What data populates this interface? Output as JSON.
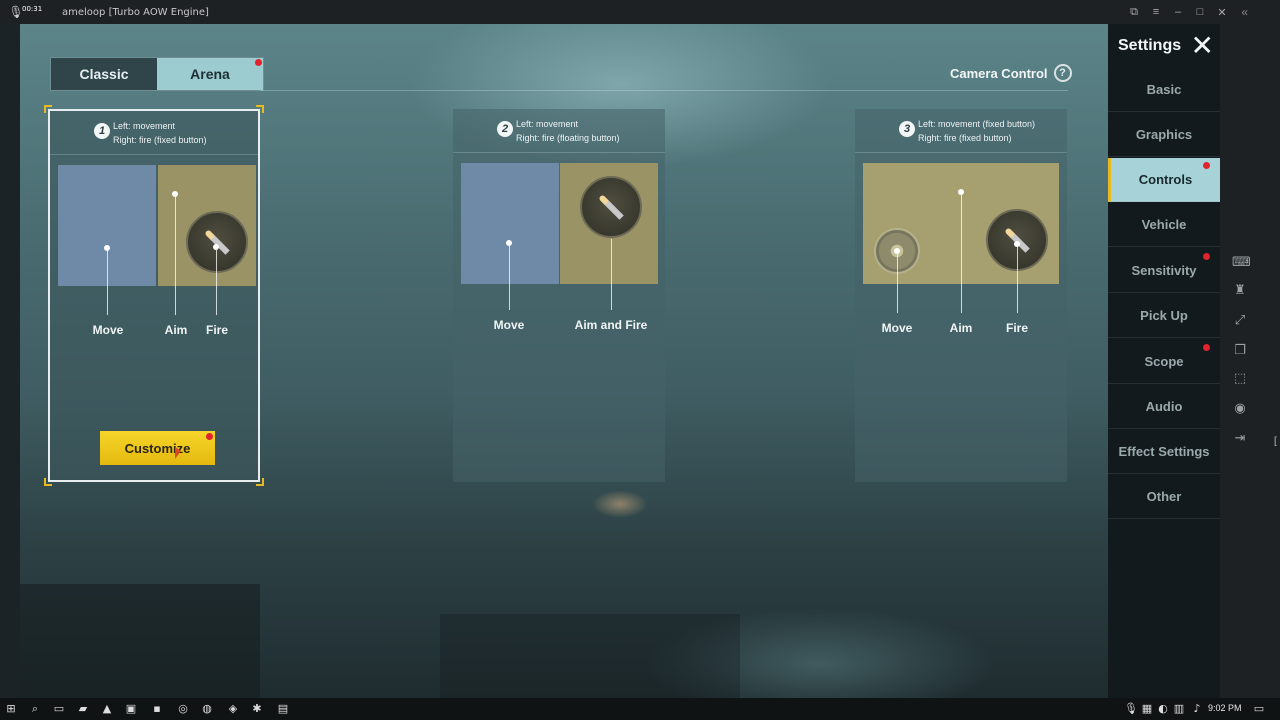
{
  "window": {
    "title": "ameloop  [Turbo AOW Engine]",
    "clock": "00:31"
  },
  "mode_tabs": [
    {
      "label": "Classic",
      "active": false
    },
    {
      "label": "Arena",
      "active": true
    }
  ],
  "camera_control": {
    "label": "Camera Control",
    "help": "?"
  },
  "schemes": [
    {
      "number": "1",
      "line1": "Left: movement",
      "line2": "Right: fire (fixed button)",
      "selected": true,
      "labels": [
        "Move",
        "Aim",
        "Fire"
      ]
    },
    {
      "number": "2",
      "line1": "Left: movement",
      "line2": "Right: fire (floating button)",
      "selected": false,
      "labels": [
        "Move",
        "Aim and Fire"
      ]
    },
    {
      "number": "3",
      "line1": "Left: movement (fixed button)",
      "line2": "Right: fire (fixed button)",
      "selected": false,
      "labels": [
        "Move",
        "Aim",
        "Fire"
      ]
    }
  ],
  "customize_label": "Customize",
  "settings": {
    "title": "Settings",
    "close": "✕",
    "items": [
      {
        "label": "Basic",
        "active": false,
        "dot": false
      },
      {
        "label": "Graphics",
        "active": false,
        "dot": false
      },
      {
        "label": "Controls",
        "active": true,
        "dot": true
      },
      {
        "label": "Vehicle",
        "active": false,
        "dot": false
      },
      {
        "label": "Sensitivity",
        "active": false,
        "dot": true
      },
      {
        "label": "Pick Up",
        "active": false,
        "dot": false
      },
      {
        "label": "Scope",
        "active": false,
        "dot": true
      },
      {
        "label": "Audio",
        "active": false,
        "dot": false
      },
      {
        "label": "Effect Settings",
        "active": false,
        "dot": false
      },
      {
        "label": "Other",
        "active": false,
        "dot": false
      }
    ]
  },
  "colors": {
    "accent_yellow": "#e8b923",
    "active_tab": "#9ccbd0",
    "notification_red": "#e0232c"
  },
  "taskbar": {
    "time": "9:02 PM"
  }
}
